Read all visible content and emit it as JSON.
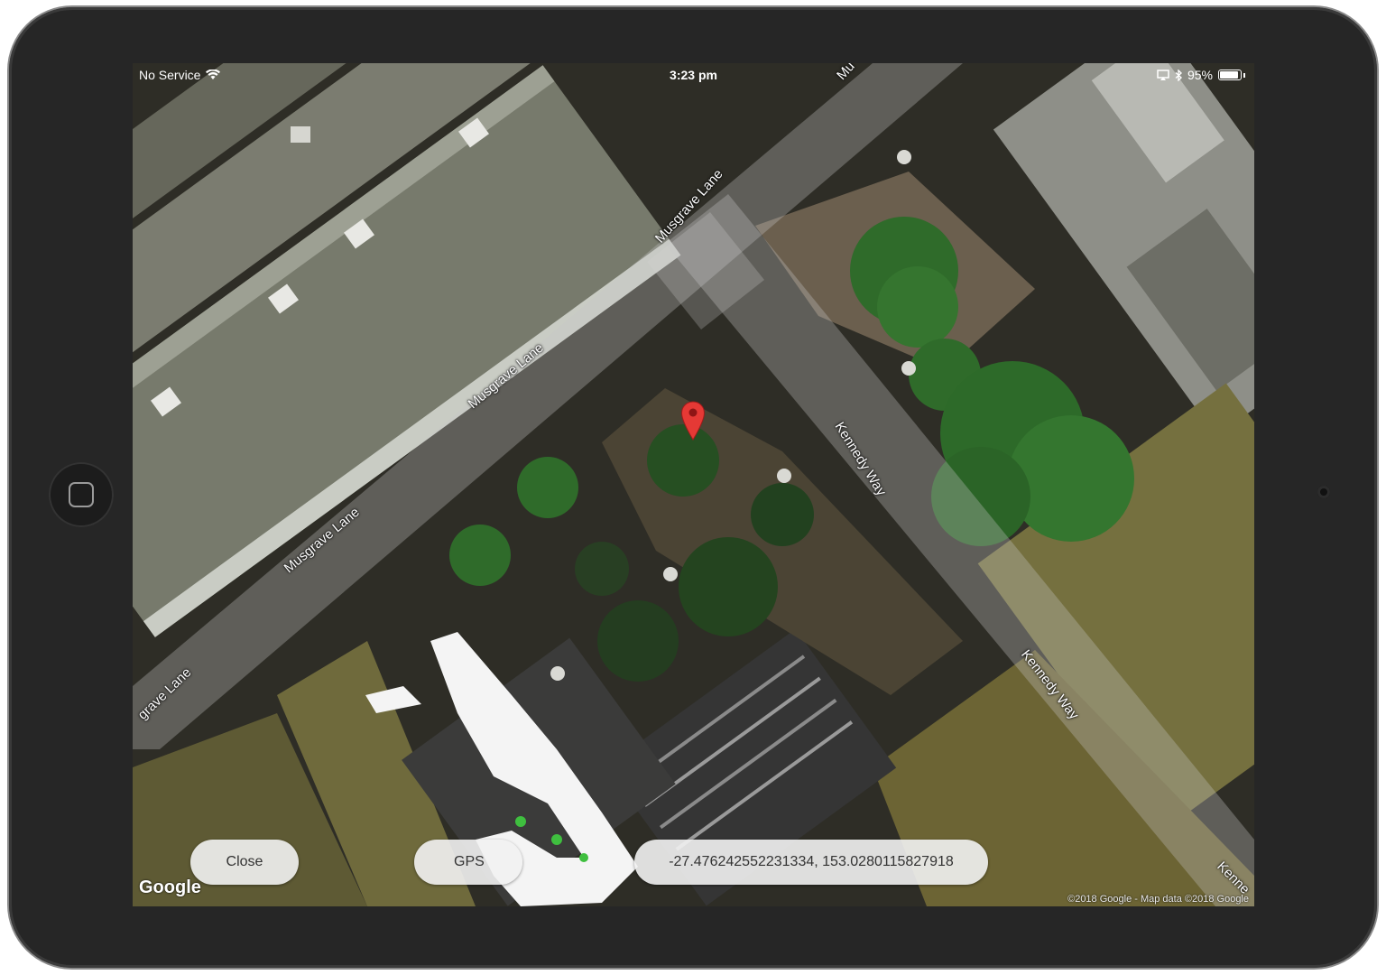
{
  "status_bar": {
    "carrier": "No Service",
    "time": "3:23 pm",
    "battery": "95%",
    "battery_level": 0.95,
    "wifi_icon": "wifi-icon",
    "bluetooth_icon": "bluetooth-icon",
    "airplay_icon": "airplay-icon"
  },
  "map": {
    "type": "satellite",
    "road_labels": {
      "musgrave_1": "Musgrave Lane",
      "musgrave_2": "Musgrave Lane",
      "musgrave_3": "Musgrave Lane",
      "musgrave_4": "grave Lane",
      "kennedy_1": "Kennedy Way",
      "kennedy_2": "Kennedy Way",
      "kennedy_3": "Kenne",
      "edge_top": "Mu"
    },
    "pin_icon": "map-pin-icon",
    "pin_color": "#e53935",
    "google_logo": "Google",
    "attribution": "©2018 Google - Map data ©2018 Google"
  },
  "controls": {
    "close_label": "Close",
    "gps_label": "GPS",
    "coordinates": "-27.476242552231334, 153.0280115827918"
  },
  "device": {
    "home_button_icon": "home-button-icon",
    "camera_icon": "camera-icon"
  }
}
